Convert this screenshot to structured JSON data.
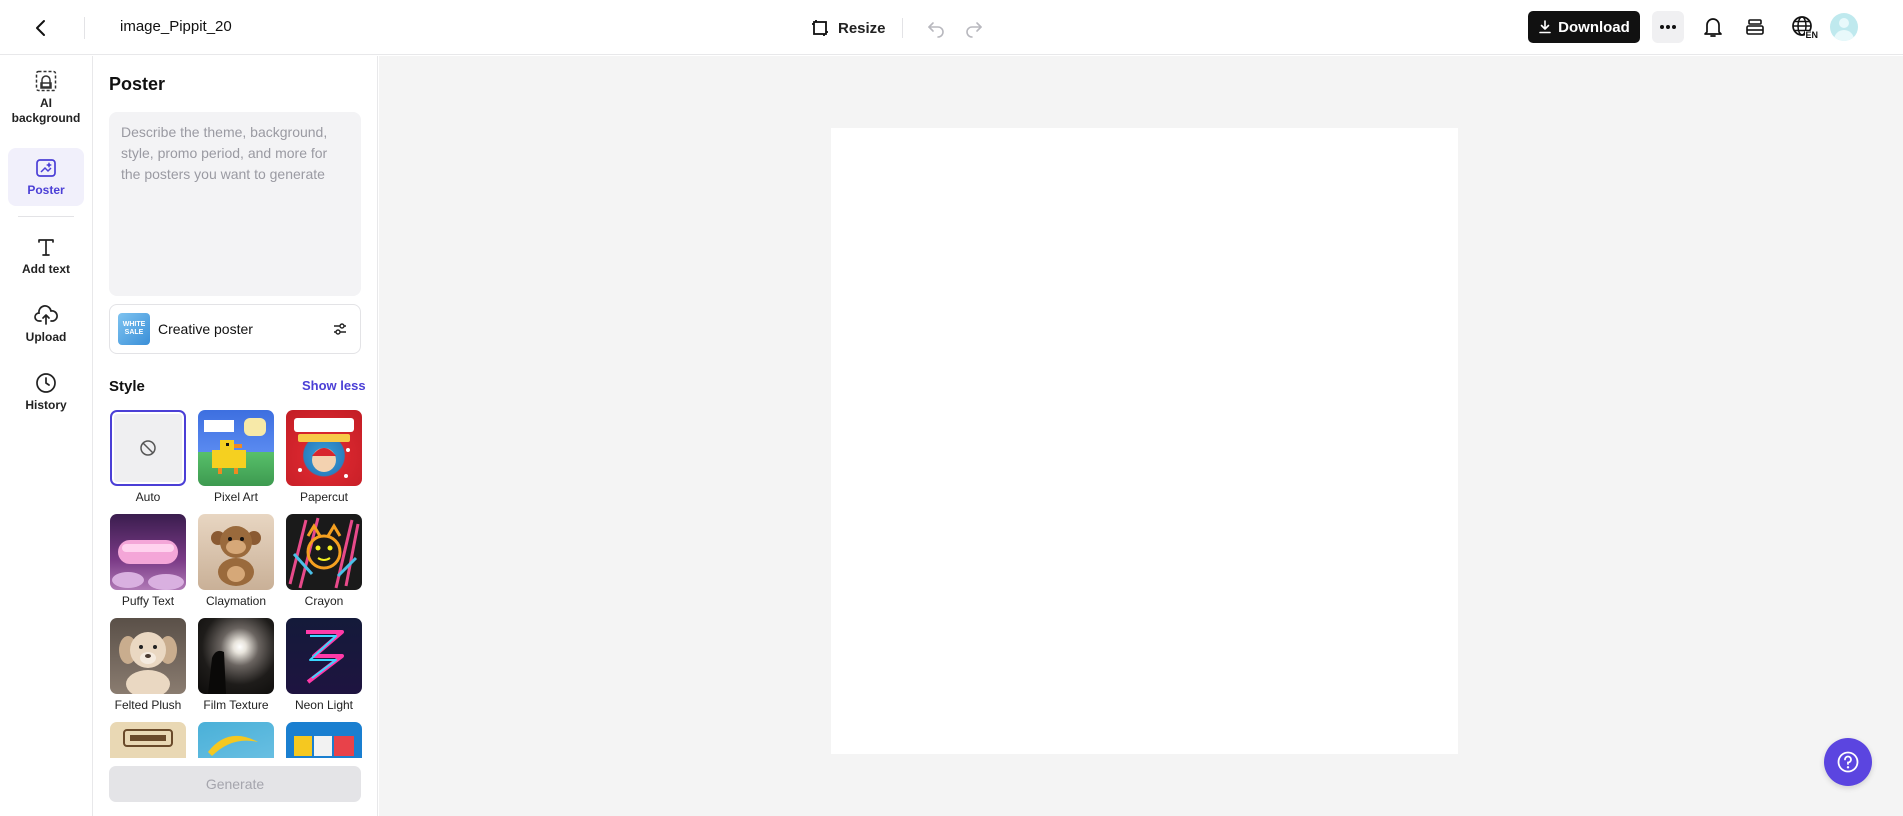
{
  "header": {
    "doc_title": "image_Pippit_20",
    "resize_label": "Resize",
    "download_label": "Download",
    "language_badge": "EN"
  },
  "rail": {
    "items": [
      {
        "label": "AI background",
        "icon": "ai-background-icon"
      },
      {
        "label": "Poster",
        "icon": "poster-icon",
        "active": true
      },
      {
        "label": "Add text",
        "icon": "text-icon"
      },
      {
        "label": "Upload",
        "icon": "cloud-upload-icon"
      },
      {
        "label": "History",
        "icon": "clock-icon"
      }
    ]
  },
  "panel": {
    "title": "Poster",
    "prompt_placeholder": "Describe the theme, background, style, promo period, and more for the posters you want to generate",
    "prompt_value": "",
    "poster_type": "Creative poster",
    "poster_thumb_text": "WHITE SALE",
    "style_label": "Style",
    "show_less": "Show less",
    "styles": [
      {
        "name": "Auto",
        "selected": true
      },
      {
        "name": "Pixel Art"
      },
      {
        "name": "Papercut"
      },
      {
        "name": "Puffy Text"
      },
      {
        "name": "Claymation"
      },
      {
        "name": "Crayon"
      },
      {
        "name": "Felted Plush"
      },
      {
        "name": "Film Texture"
      },
      {
        "name": "Neon Light"
      },
      {
        "name": ""
      },
      {
        "name": ""
      },
      {
        "name": ""
      }
    ],
    "generate_label": "Generate"
  },
  "colors": {
    "accent": "#4b3fd6",
    "help_button": "#5b45e0",
    "download_bg": "#111111",
    "workspace_bg": "#f4f4f4"
  }
}
